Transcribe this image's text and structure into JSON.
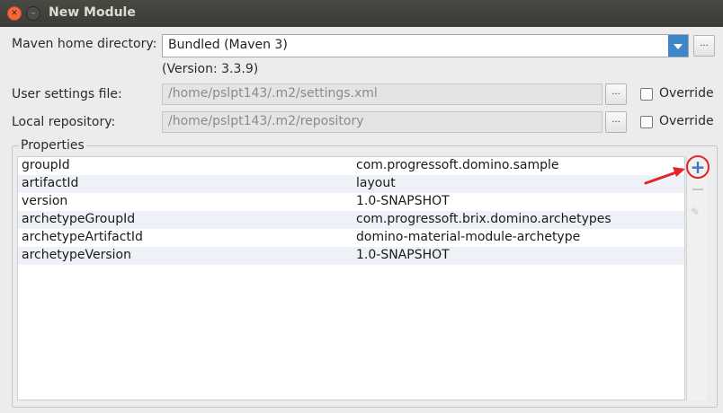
{
  "window": {
    "title": "New Module",
    "close_glyph": "✕",
    "minimize_glyph": "–"
  },
  "maven_home": {
    "label": "Maven home directory:",
    "value": "Bundled (Maven 3)",
    "browse_label": "...",
    "version": "(Version: 3.3.9)"
  },
  "user_settings": {
    "label": "User settings file:",
    "value": "/home/pslpt143/.m2/settings.xml",
    "browse_label": "...",
    "override_label": "Override",
    "override_checked": false
  },
  "local_repository": {
    "label": "Local repository:",
    "value": "/home/pslpt143/.m2/repository",
    "browse_label": "...",
    "override_label": "Override",
    "override_checked": false
  },
  "properties": {
    "title": "Properties",
    "rows": [
      {
        "key": "groupId",
        "value": "com.progressoft.domino.sample"
      },
      {
        "key": "artifactId",
        "value": "layout"
      },
      {
        "key": "version",
        "value": "1.0-SNAPSHOT"
      },
      {
        "key": "archetypeGroupId",
        "value": "com.progressoft.brix.domino.archetypes"
      },
      {
        "key": "archetypeArtifactId",
        "value": "domino-material-module-archetype"
      },
      {
        "key": "archetypeVersion",
        "value": "1.0-SNAPSHOT"
      }
    ],
    "toolbar": {
      "add_glyph": "+",
      "edit_glyph": "✎"
    }
  },
  "annotation_color": "#e0242a",
  "accent_color": "#3c86c9"
}
